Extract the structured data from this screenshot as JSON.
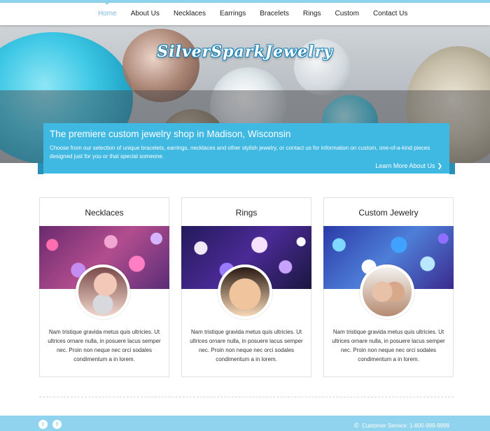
{
  "colors": {
    "accent": "#8fd3ee",
    "banner": "#3fb8e2",
    "nav_active": "#7fb7d9"
  },
  "nav": {
    "items": [
      {
        "label": "Home",
        "active": true
      },
      {
        "label": "About Us",
        "active": false
      },
      {
        "label": "Necklaces",
        "active": false
      },
      {
        "label": "Earrings",
        "active": false
      },
      {
        "label": "Bracelets",
        "active": false
      },
      {
        "label": "Rings",
        "active": false
      },
      {
        "label": "Custom",
        "active": false
      },
      {
        "label": "Contact Us",
        "active": false
      }
    ]
  },
  "hero": {
    "logo_text": "SilverSparkJewelry",
    "headline": "The premiere custom jewelry shop in Madison, Wisconsin",
    "body": "Choose from our selection of unique bracelets, earrings, necklaces and other stylish jewelry, or contact us for information on custom, one-of-a-kind pieces designed just for you or that special someone.",
    "cta": "Learn More About Us",
    "cta_icon": "chevron-right-icon"
  },
  "cards": [
    {
      "title": "Necklaces",
      "text": "Nam tristique gravida metus quis ultricies. Ut ultrices ornare nulla, in posuere lacus semper nec. Proin non neque nec orci sodales condimentum a in lorem."
    },
    {
      "title": "Rings",
      "text": "Nam tristique gravida metus quis ultricies. Ut ultrices ornare nulla, in posuere lacus semper nec. Proin non neque nec orci sodales condimentum a in lorem."
    },
    {
      "title": "Custom Jewelry",
      "text": "Nam tristique gravida metus quis ultricies. Ut ultrices ornare nulla, in posuere lacus semper nec. Proin non neque nec orci sodales condimentum a in lorem."
    }
  ],
  "footer": {
    "social_icons": [
      "twitter-icon",
      "facebook-icon"
    ],
    "customer_service": "Customer Service: 1-800-999-9999",
    "phone_icon": "phone-icon"
  }
}
